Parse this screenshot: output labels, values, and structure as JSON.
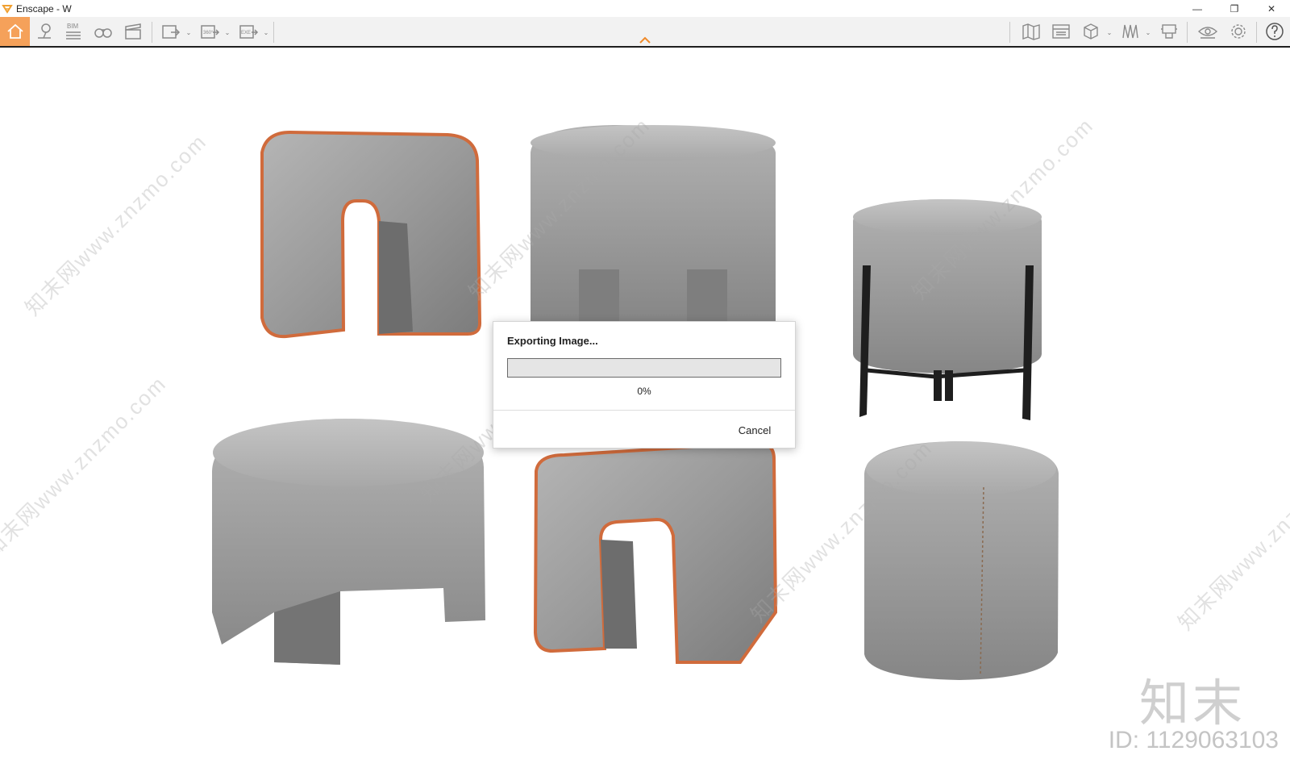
{
  "window": {
    "title": "Enscape - W",
    "icon": "enscape-logo-icon",
    "accent_color": "#f5a15a"
  },
  "window_controls": {
    "minimize": "—",
    "restore": "❐",
    "close": "✕"
  },
  "toolbar": {
    "home": "home-icon",
    "bim_label": "BIM",
    "vr_360_label": "360°",
    "exe_label": "EXE",
    "dropdown_caret": "⌄"
  },
  "dialog": {
    "title": "Exporting Image...",
    "progress": 0,
    "percent_text": "0%",
    "cancel_label": "Cancel"
  },
  "viewport": {
    "watermark_text": "知末网www.znzmo.com",
    "brand_text": "知末",
    "id_text": "ID: 1129063103"
  }
}
